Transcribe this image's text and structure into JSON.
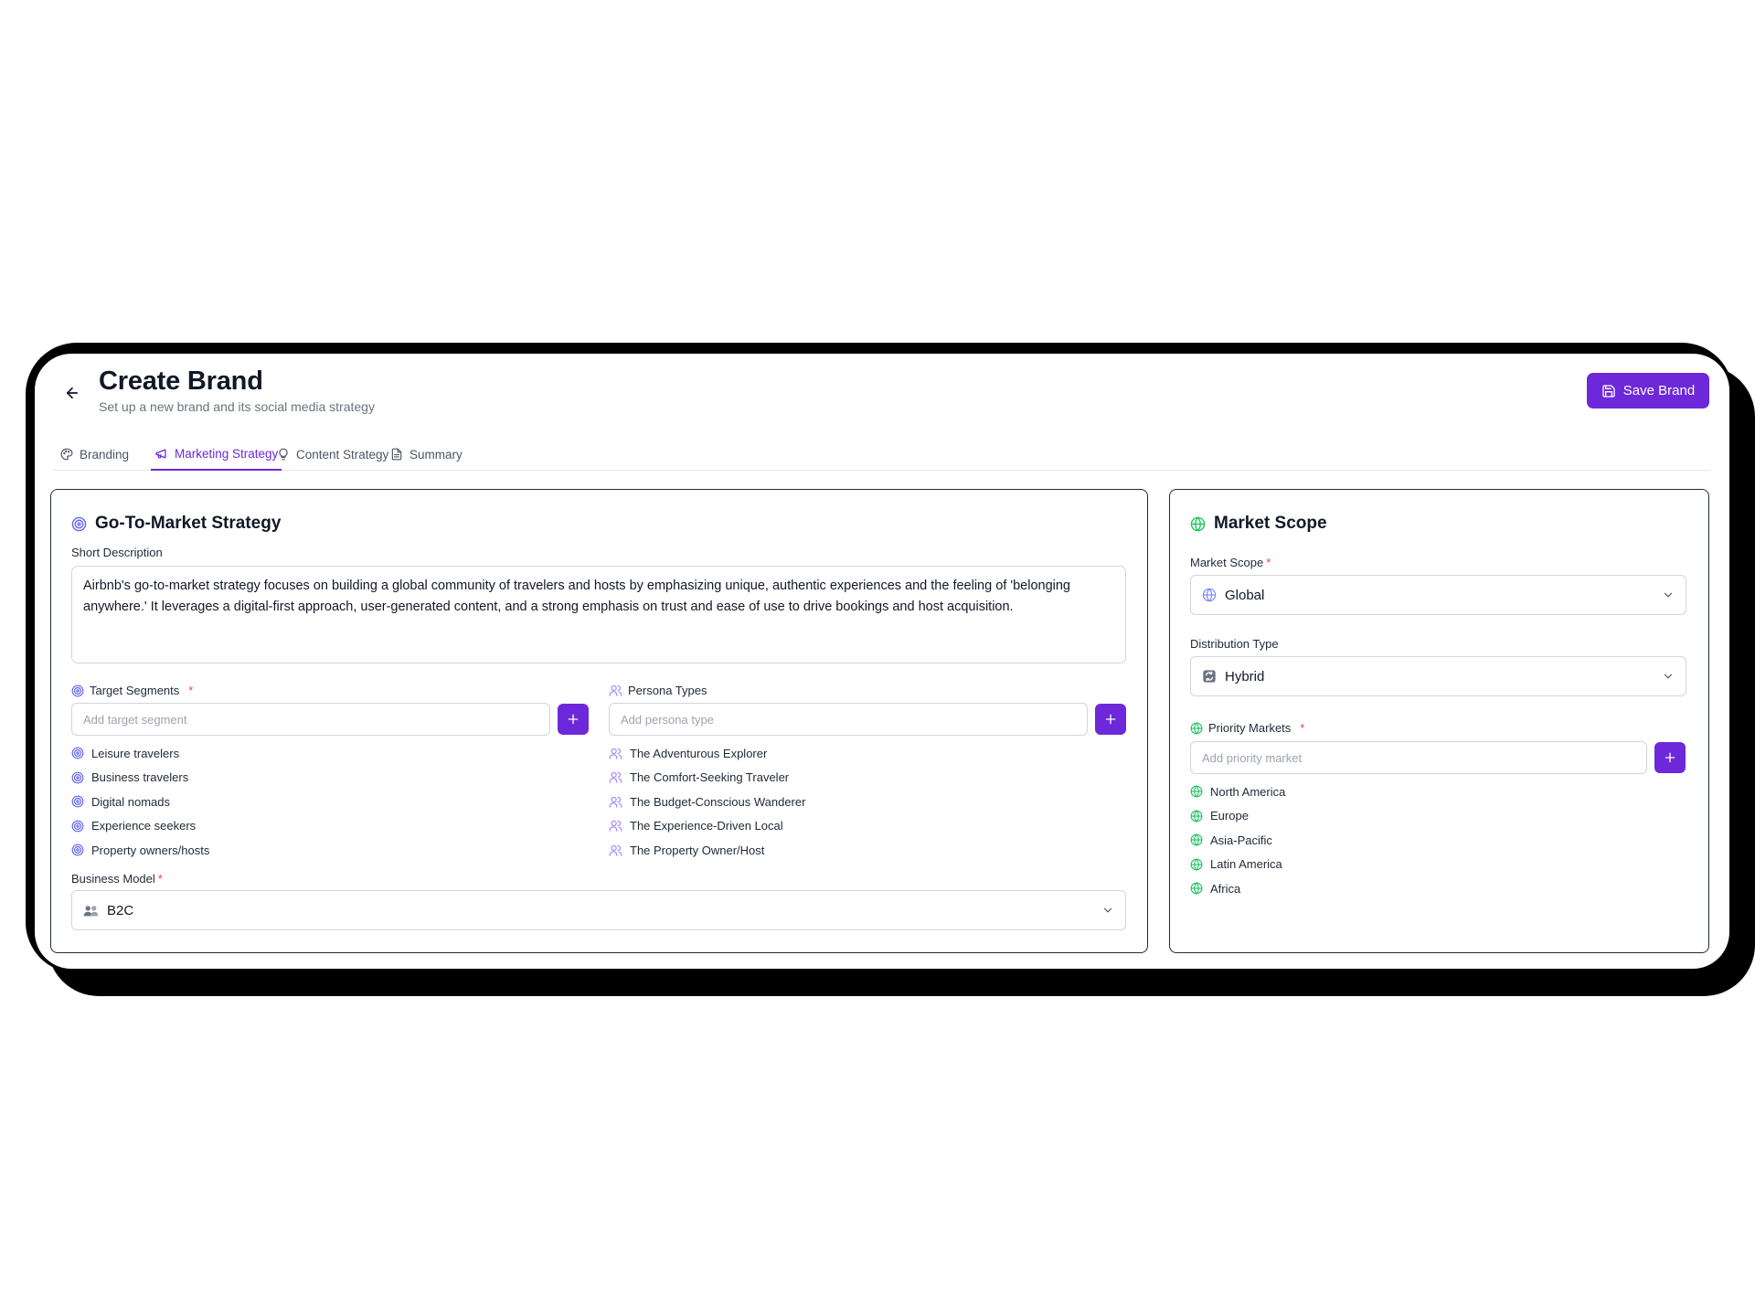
{
  "header": {
    "title": "Create Brand",
    "subtitle": "Set up a new brand and its social media strategy",
    "save_label": "Save Brand"
  },
  "tabs": [
    {
      "label": "Branding",
      "icon": "palette-icon",
      "active": false
    },
    {
      "label": "Marketing Strategy",
      "icon": "megaphone-icon",
      "active": true
    },
    {
      "label": "Content Strategy",
      "icon": "lightbulb-icon",
      "active": false
    },
    {
      "label": "Summary",
      "icon": "document-icon",
      "active": false
    }
  ],
  "gtm": {
    "title": "Go-To-Market Strategy",
    "description_label": "Short Description",
    "description": "Airbnb's go-to-market strategy focuses on building a global community of travelers and hosts by emphasizing unique, authentic experiences and the feeling of 'belonging anywhere.' It leverages a digital-first approach, user-generated content, and a strong emphasis on trust and ease of use to drive bookings and host acquisition.",
    "segments": {
      "label": "Target Segments",
      "required": "*",
      "placeholder": "Add target segment",
      "items": [
        "Leisure travelers",
        "Business travelers",
        "Digital nomads",
        "Experience seekers",
        "Property owners/hosts"
      ]
    },
    "personas": {
      "label": "Persona Types",
      "placeholder": "Add persona type",
      "items": [
        "The Adventurous Explorer",
        "The Comfort-Seeking Traveler",
        "The Budget-Conscious Wanderer",
        "The Experience-Driven Local",
        "The Property Owner/Host"
      ]
    },
    "business_model": {
      "label": "Business Model",
      "required": "*",
      "value": "B2C"
    }
  },
  "market": {
    "title": "Market Scope",
    "scope": {
      "label": "Market Scope",
      "required": "*",
      "value": "Global"
    },
    "distribution": {
      "label": "Distribution Type",
      "value": "Hybrid"
    },
    "priority": {
      "label": "Priority Markets",
      "required": "*",
      "placeholder": "Add priority market",
      "items": [
        "North America",
        "Europe",
        "Asia-Pacific",
        "Latin America",
        "Africa"
      ]
    }
  },
  "colors": {
    "accent": "#6d28d9",
    "target_icon": "#6366f1",
    "persona_icon": "#a78bfa",
    "globe_icon": "#22c55e",
    "required": "#ef4444"
  }
}
